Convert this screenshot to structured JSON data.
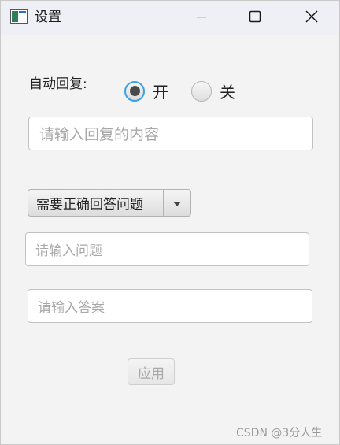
{
  "window": {
    "title": "设置",
    "icon": "app-window-icon",
    "controls": [
      "minimize-icon",
      "maximize-icon",
      "close-icon"
    ]
  },
  "auto_reply": {
    "label": "自动回复:",
    "options": [
      {
        "label": "开",
        "selected": true
      },
      {
        "label": "关",
        "selected": false
      }
    ],
    "content_placeholder": "请输入回复的内容"
  },
  "verification": {
    "mode_selected": "需要正确回答问题",
    "question_placeholder": "请输入问题",
    "answer_placeholder": "请输入答案"
  },
  "actions": {
    "apply_label": "应用"
  },
  "watermark": "CSDN @3分人生",
  "colors": {
    "focus_accent": "#3aa0e8",
    "titlebar_bg": "#eef0f6"
  }
}
